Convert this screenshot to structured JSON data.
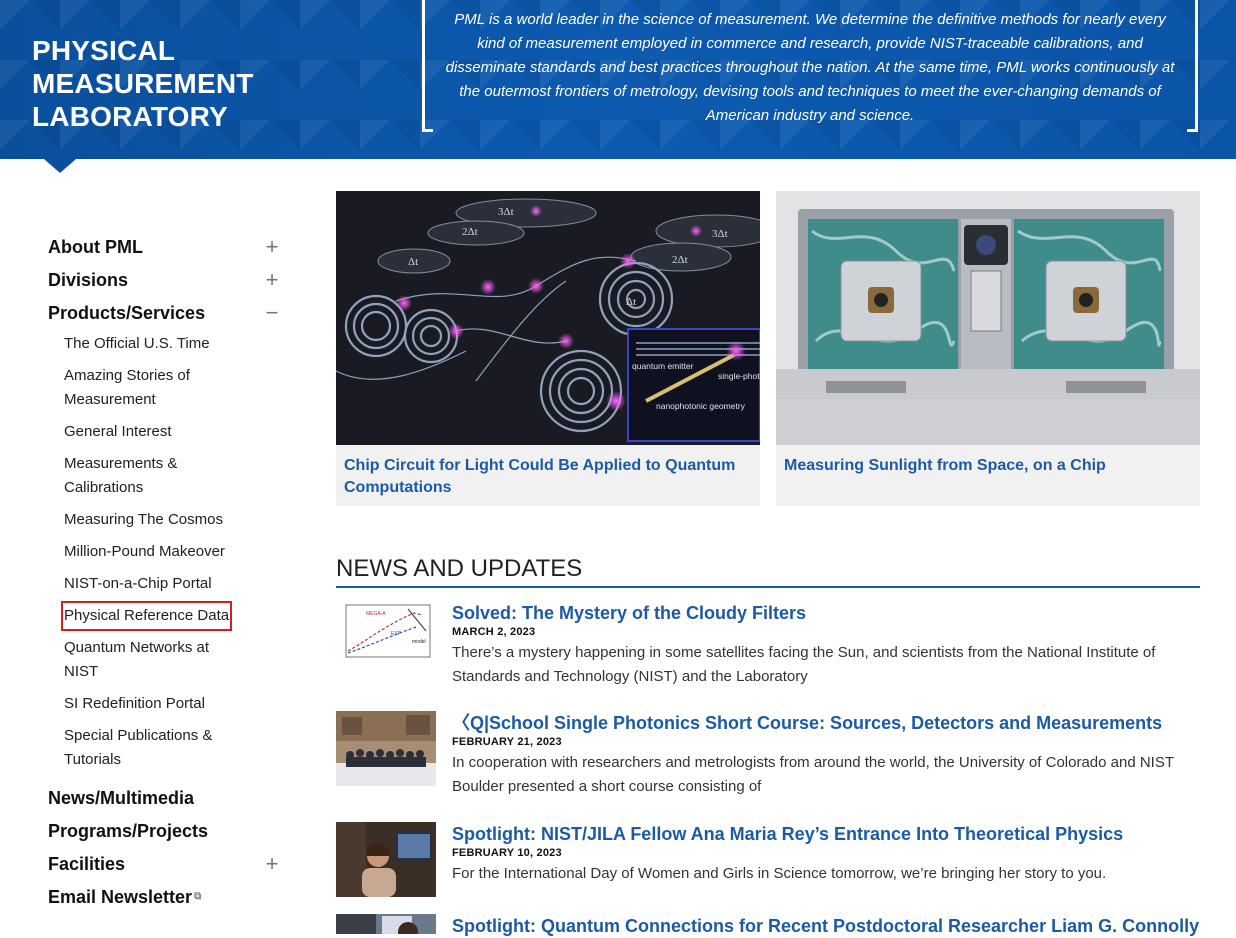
{
  "header": {
    "site_title": "PHYSICAL MEASUREMENT LABORATORY",
    "mission": "PML is a world leader in the science of measurement. We determine the definitive methods for nearly every kind of measurement employed in commerce and research, provide NIST-traceable calibrations, and disseminate standards and best practices throughout the nation. At the same time, PML works continuously at the outermost frontiers of metrology, devising tools and techniques to meet the ever-changing demands of American industry and science.",
    "brand_color": "#0a4f9c"
  },
  "sidebar": {
    "sections": [
      {
        "label": "About PML",
        "toggle": "+"
      },
      {
        "label": "Divisions",
        "toggle": "+"
      },
      {
        "label": "Products/Services",
        "toggle": "−"
      }
    ],
    "products_items": [
      "The Official U.S. Time",
      "Amazing Stories of Measurement",
      "General Interest",
      "Measurements & Calibrations",
      "Measuring The Cosmos",
      "Million-Pound Makeover",
      "NIST-on-a-Chip Portal",
      "Physical Reference Data",
      "Quantum Networks at NIST",
      "SI Redefinition Portal",
      "Special Publications & Tutorials"
    ],
    "more_sections": [
      {
        "label": "News/Multimedia",
        "toggle": ""
      },
      {
        "label": "Programs/Projects",
        "toggle": ""
      },
      {
        "label": "Facilities",
        "toggle": "+"
      },
      {
        "label": "Email Newsletter",
        "toggle": ""
      }
    ],
    "highlighted_item": "Physical Reference Data",
    "highlight_color": "#d21f1f"
  },
  "features": [
    {
      "caption": "Chip Circuit for Light Could Be Applied to Quantum Computations",
      "image_labels": [
        "3Δt",
        "2Δt",
        "3Δt",
        "2Δt",
        "Δt",
        "Δt",
        "quantum emitter",
        "single-photo",
        "nanophotonic geometry"
      ]
    },
    {
      "caption": "Measuring Sunlight from Space, on a Chip"
    }
  ],
  "news": {
    "heading": "NEWS AND UPDATES",
    "items": [
      {
        "title": "Solved: The Mystery of the Cloudy Filters",
        "date": "MARCH 2, 2023",
        "summary": "There’s a mystery happening in some satellites facing the Sun, and scientists from the National Institute of Standards and Technology (NIST) and the Laboratory",
        "thumb_labels": [
          "MEGA-A",
          "ESP",
          "model"
        ]
      },
      {
        "title": "〈Q|School Single Photonics Short Course: Sources, Detectors and Measurements",
        "date": "FEBRUARY 21, 2023",
        "summary": "In cooperation with researchers and metrologists from around the world, the University of Colorado and NIST Boulder presented a short course consisting of"
      },
      {
        "title": "Spotlight: NIST/JILA Fellow Ana Maria Rey’s Entrance Into Theoretical Physics",
        "date": "FEBRUARY 10, 2023",
        "summary": "For the International Day of Women and Girls in Science tomorrow, we’re bringing her story to you."
      },
      {
        "title": "Spotlight: Quantum Connections for Recent Postdoctoral Researcher Liam G. Connolly",
        "date": "",
        "summary": ""
      }
    ]
  }
}
